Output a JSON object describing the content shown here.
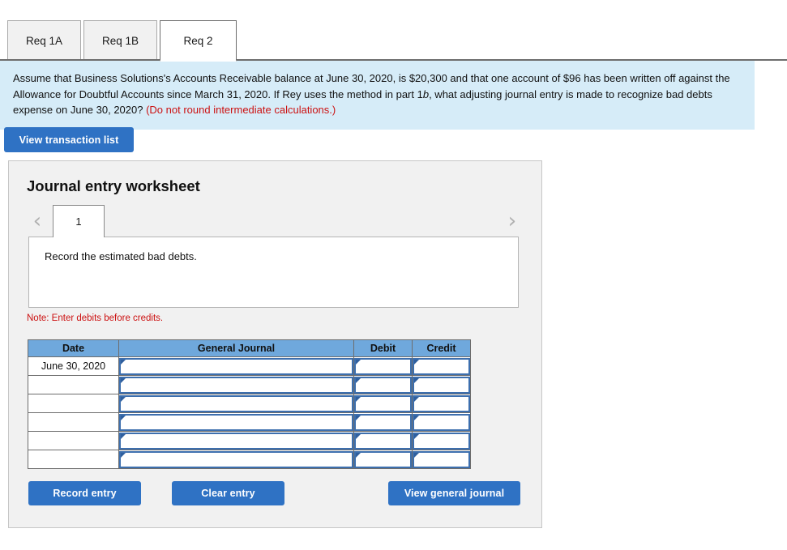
{
  "tabs": [
    {
      "label": "Req 1A",
      "active": false
    },
    {
      "label": "Req 1B",
      "active": false
    },
    {
      "label": "Req 2",
      "active": true
    }
  ],
  "banner": {
    "part1": "Assume that Business Solutions's Accounts Receivable balance at June 30, 2020, is $20,300 and that one account of $96 has been written off against the Allowance for Doubtful Accounts since March 31, 2020. If Rey uses the method in part 1",
    "italic": "b",
    "part2": ", what adjusting journal entry is made to recognize bad debts expense on June 30, 2020? ",
    "note": "(Do not round intermediate calculations.)"
  },
  "toolbar": {
    "view_transaction_list": "View transaction list"
  },
  "worksheet": {
    "title": "Journal entry worksheet",
    "prev_icon": "chevron-left-icon",
    "next_icon": "chevron-right-icon",
    "page_tabs": [
      "1"
    ],
    "description": "Record the estimated bad debts.",
    "note": "Note: Enter debits before credits."
  },
  "table": {
    "headers": [
      "Date",
      "General Journal",
      "Debit",
      "Credit"
    ],
    "rows": [
      {
        "date": "June 30, 2020",
        "general_journal": "",
        "debit": "",
        "credit": ""
      },
      {
        "date": "",
        "general_journal": "",
        "debit": "",
        "credit": ""
      },
      {
        "date": "",
        "general_journal": "",
        "debit": "",
        "credit": ""
      },
      {
        "date": "",
        "general_journal": "",
        "debit": "",
        "credit": ""
      },
      {
        "date": "",
        "general_journal": "",
        "debit": "",
        "credit": ""
      },
      {
        "date": "",
        "general_journal": "",
        "debit": "",
        "credit": ""
      }
    ]
  },
  "footer": {
    "record_entry": "Record entry",
    "clear_entry": "Clear entry",
    "view_general_journal": "View general journal"
  },
  "colors": {
    "accent_blue": "#2f72c4",
    "banner_bg": "#d6ecf8",
    "table_header_bg": "#6fa8dc",
    "alert_red": "#cc1111",
    "panel_bg": "#f1f1f1"
  }
}
